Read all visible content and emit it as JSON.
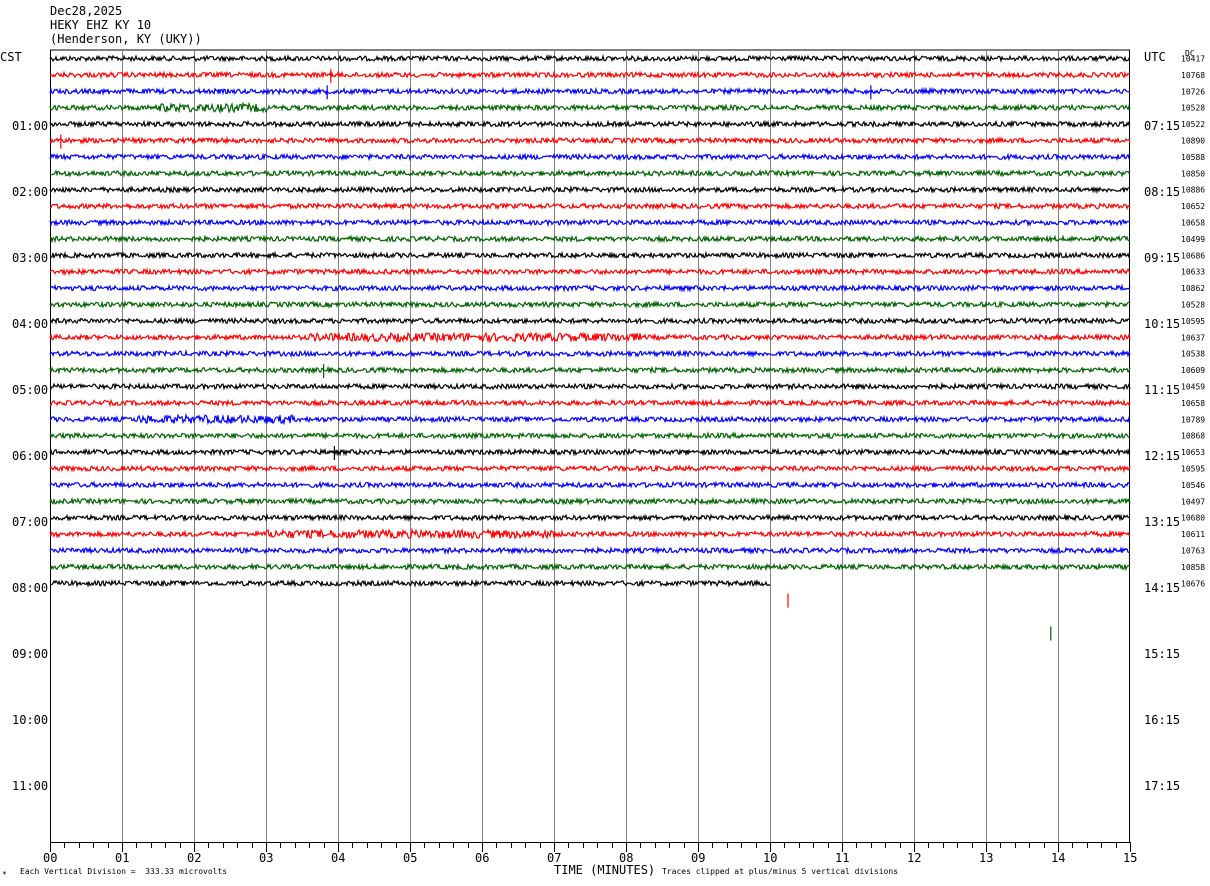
{
  "header": {
    "date": "Dec28,2025",
    "station": "HEKY EHZ KY 10",
    "location": "(Henderson, KY (UKY))"
  },
  "left_tz": "CST",
  "right_tz": "UTC",
  "dc_label": "DC",
  "footer": {
    "mark": "*",
    "division_note": "Each Vertical Division =  333.33 microvolts",
    "clip_note": "Traces clipped at plus/minus 5 vertical divisions"
  },
  "colors": {
    "black": "#000000",
    "red": "#ff0000",
    "blue": "#0000ff",
    "green": "#006400",
    "grid": "#808080"
  },
  "chart_data": {
    "type": "line",
    "title": "HEKY EHZ KY 10",
    "xlabel": "TIME (MINUTES)",
    "xlim": [
      0,
      15
    ],
    "x_ticks": [
      "00",
      "01",
      "02",
      "03",
      "04",
      "05",
      "06",
      "07",
      "08",
      "09",
      "10",
      "11",
      "12",
      "13",
      "14",
      "15"
    ],
    "left_hour_labels": [
      "01:00",
      "02:00",
      "03:00",
      "04:00",
      "05:00",
      "06:00",
      "07:00",
      "08:00",
      "09:00",
      "10:00",
      "11:00"
    ],
    "right_hour_labels": [
      "07:15",
      "08:15",
      "09:15",
      "10:15",
      "11:15",
      "12:15",
      "13:15",
      "14:15",
      "15:15",
      "16:15",
      "17:15"
    ],
    "trace_color_cycle": [
      "black",
      "red",
      "blue",
      "green"
    ],
    "trace_count": 33,
    "last_trace_end_minute": 10.0,
    "dc_values": [
      "10417",
      "10768",
      "10726",
      "10528",
      "10522",
      "10890",
      "10588",
      "10850",
      "10886",
      "10652",
      "10658",
      "10499",
      "10686",
      "10633",
      "10862",
      "10528",
      "10595",
      "10637",
      "10538",
      "10609",
      "10459",
      "10658",
      "10789",
      "10868",
      "10653",
      "10595",
      "10546",
      "10497",
      "10680",
      "10611",
      "10763",
      "10858",
      "10676"
    ],
    "noise_segments": [
      {
        "trace": 3,
        "x": [
          1.5,
          3.0
        ]
      },
      {
        "trace": 17,
        "x": [
          3.6,
          8.2
        ]
      },
      {
        "trace": 22,
        "x": [
          1.2,
          3.4
        ]
      },
      {
        "trace": 29,
        "x": [
          3.0,
          7.0
        ]
      }
    ],
    "spikes": [
      {
        "trace": 1,
        "x": 3.9
      },
      {
        "trace": 2,
        "x": 3.85
      },
      {
        "trace": 2,
        "x": 11.4
      },
      {
        "trace": 5,
        "x": 0.15
      },
      {
        "trace": 19,
        "x": 3.8
      },
      {
        "trace": 24,
        "x": 3.95
      },
      {
        "trace": 33,
        "x": 10.25
      },
      {
        "trace": 35,
        "x": 13.9
      }
    ]
  }
}
